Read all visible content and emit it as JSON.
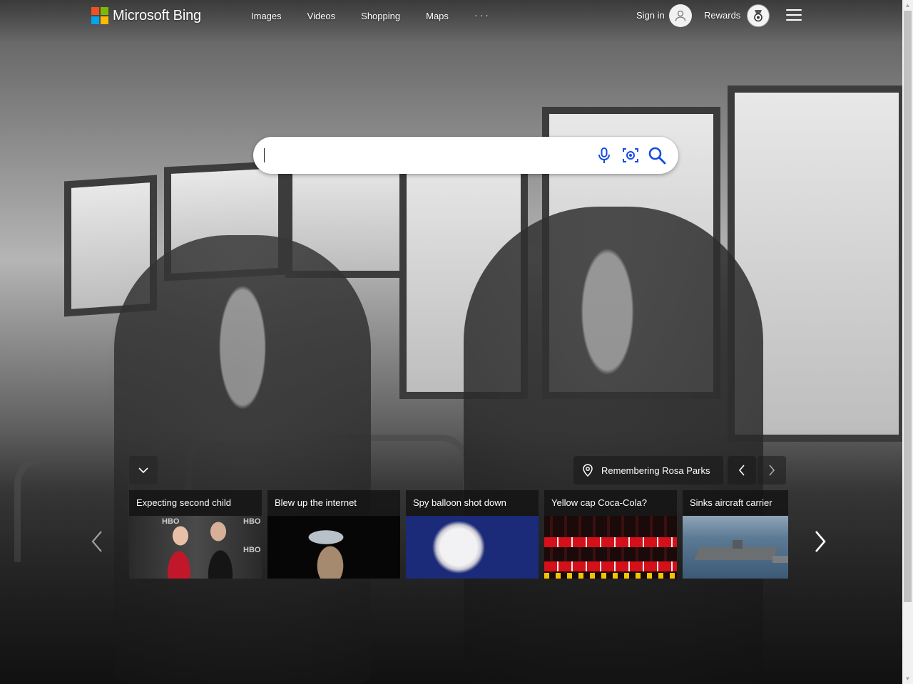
{
  "brand": {
    "name": "Microsoft Bing",
    "logo_colors": [
      "#f25022",
      "#7fba00",
      "#00a4ef",
      "#ffb900"
    ]
  },
  "nav": {
    "items": [
      {
        "label": "Images"
      },
      {
        "label": "Videos"
      },
      {
        "label": "Shopping"
      },
      {
        "label": "Maps"
      }
    ],
    "more_label": "···"
  },
  "account": {
    "sign_in_label": "Sign in",
    "rewards_label": "Rewards"
  },
  "search": {
    "value": "",
    "icons": [
      "microphone-icon",
      "visual-search-icon",
      "search-icon"
    ],
    "accent_color": "#174ae4"
  },
  "image_of_day": {
    "location_label": "Remembering Rosa Parks"
  },
  "news": [
    {
      "title": "Expecting second child",
      "thumb": "red-carpet-couple"
    },
    {
      "title": "Blew up the internet",
      "thumb": "cowboy-hat-performer"
    },
    {
      "title": "Spy balloon shot down",
      "thumb": "balloon-in-blue-sky"
    },
    {
      "title": "Yellow cap Coca-Cola?",
      "thumb": "coca-cola-bottles"
    },
    {
      "title": "Sinks aircraft carrier",
      "thumb": "aircraft-carrier-at-sea"
    }
  ]
}
